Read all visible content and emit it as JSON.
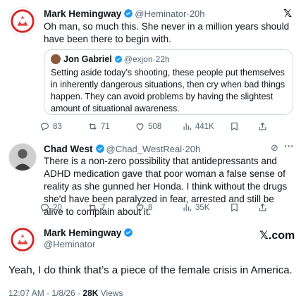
{
  "colors": {
    "verified": "#1d9bf0",
    "text": "#0f1419",
    "muted": "#536471",
    "border": "#cfd9de"
  },
  "tweet1": {
    "name": "Mark Hemingway",
    "handle": "@Heminator",
    "time": "20h",
    "text": "Oh man, so much this. She never in a million years should have been there to begin with.",
    "quote": {
      "name": "Jon Gabriel",
      "handle": "@exjon",
      "time": "22h",
      "text": "Setting aside today’s shooting, these people put themselves in inherently dangerous situations, then cry when bad things happen. They can avoid problems by having the slightest amount of situational awareness."
    },
    "stats": {
      "replies": "83",
      "reposts": "71",
      "likes": "508",
      "views": "441K"
    }
  },
  "tweet2": {
    "name": "Chad West",
    "handle": "@Chad_WestReal",
    "time": "20h",
    "text": "There is a non-zero possibility that antidepressants and ADHD medication gave that poor woman a false sense of reality as she gunned her Honda. I think without the drugs she'd have been paralyzed in fear, arrested and still be alive to complain about it.",
    "stats": {
      "replies": "20",
      "reposts": "7",
      "likes": "8",
      "views": "35K"
    }
  },
  "main": {
    "name": "Mark Hemingway",
    "handle": "@Heminator",
    "brand": "𝕏.com",
    "text": "Yeah, I do think that’s a piece of the female crisis in America.",
    "time": "12:07 AM · 1/8/26",
    "views_count": "28K",
    "views_label": " Views"
  }
}
